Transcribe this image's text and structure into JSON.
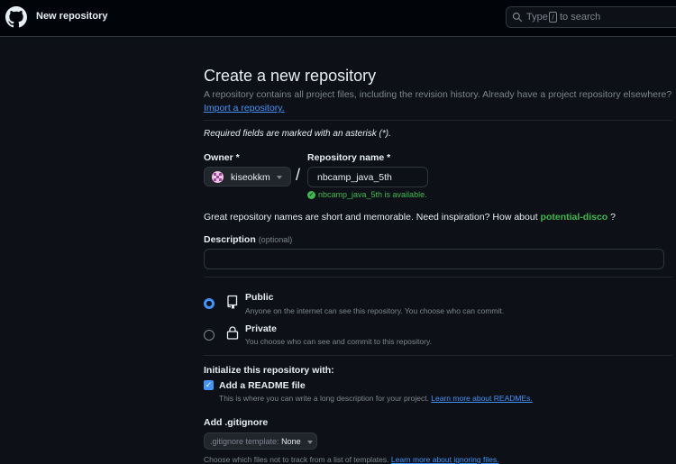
{
  "header": {
    "title": "New repository",
    "search_type": "Type",
    "search_key": "/",
    "search_rest": "to search"
  },
  "page": {
    "title": "Create a new repository",
    "description": "A repository contains all project files, including the revision history. Already have a project repository elsewhere?",
    "import_link": "Import a repository.",
    "required_note": "Required fields are marked with an asterisk (*)."
  },
  "owner": {
    "label": "Owner *",
    "value": "kiseokkm"
  },
  "repo": {
    "label": "Repository name *",
    "value": "nbcamp_java_5th",
    "availability": "nbcamp_java_5th is available."
  },
  "separator": "/",
  "inspiration": {
    "text": "Great repository names are short and memorable. Need inspiration? How about",
    "suggestion": "potential-disco",
    "suffix": "?"
  },
  "description_field": {
    "label": "Description",
    "optional": "(optional)",
    "value": ""
  },
  "visibility": {
    "public_title": "Public",
    "public_desc": "Anyone on the internet can see this repository. You choose who can commit.",
    "private_title": "Private",
    "private_desc": "You choose who can see and commit to this repository.",
    "selected": "public"
  },
  "init": {
    "title": "Initialize this repository with:",
    "readme_label": "Add a README file",
    "readme_checked": true,
    "readme_desc": "This is where you can write a long description for your project.",
    "readme_link": "Learn more about READMEs."
  },
  "gitignore": {
    "label": "Add .gitignore",
    "template_label": ".gitignore template:",
    "template_value": "None",
    "hint": "Choose which files not to track from a list of templates.",
    "hint_link": "Learn more about ignoring files."
  },
  "colors": {
    "background": "#0d1117",
    "header_bg": "#010409",
    "accent_blue": "#4493f8",
    "success_green": "#3fb950",
    "muted": "#7d8590",
    "border": "#30363d"
  }
}
